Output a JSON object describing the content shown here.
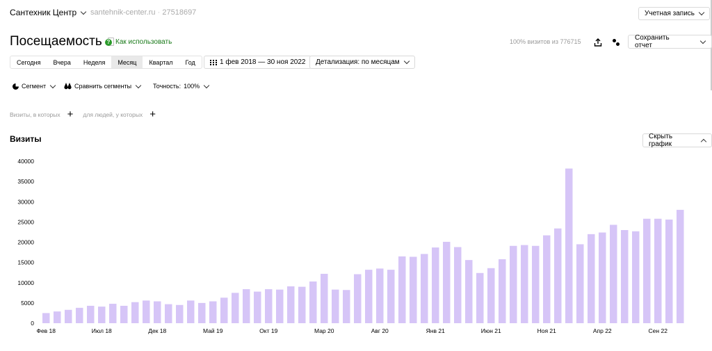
{
  "header": {
    "site_name": "Сантехник Центр",
    "site_url": "santehnik-center.ru",
    "counter_id": "27518697",
    "account_label": "Учетная запись"
  },
  "report": {
    "title": "Посещаемость",
    "howto_label": "Как использовать",
    "visits_info": "100% визитов из 776715",
    "save_label": "Сохранить отчет"
  },
  "periods": [
    "Сегодня",
    "Вчера",
    "Неделя",
    "Месяц",
    "Квартал",
    "Год"
  ],
  "active_period": "Месяц",
  "date_range": "1 фев 2018 — 30 ноя 2022",
  "detail_label": "Детализация: по месяцам",
  "segment_label": "Сегмент",
  "compare_label": "Сравнить сегменты",
  "accuracy_label": "Точность:",
  "accuracy_value": "100%",
  "filters": {
    "visits_label": "Визиты, в которых",
    "people_label": "для людей, у которых"
  },
  "chart_section": {
    "title": "Визиты",
    "hide_label": "Скрыть график"
  },
  "colors": {
    "bar": "#d6c5f7",
    "accent_green": "#2a9a2a"
  },
  "chart_data": {
    "type": "bar",
    "series": [
      {
        "values": [
          2500,
          2900,
          3300,
          3800,
          4300,
          4100,
          4800,
          4300,
          5200,
          5600,
          5400,
          4700,
          4500,
          5600,
          5000,
          5400,
          6300,
          7500,
          8400,
          7800,
          8400,
          8300,
          9100,
          9000,
          10300,
          12200,
          8300,
          8200,
          12100,
          13200,
          13500,
          13200,
          16500,
          16400,
          17100,
          18700,
          20100,
          18800,
          15600,
          12400,
          13600,
          15800,
          19100,
          19300,
          19100,
          21700,
          23400,
          38200,
          19500,
          22000,
          22400,
          24300,
          23000,
          22700,
          25800,
          25800,
          25600,
          28000
        ]
      }
    ],
    "x_tick_labels": [
      {
        "index": 0,
        "label": "Фев 18"
      },
      {
        "index": 5,
        "label": "Июл 18"
      },
      {
        "index": 10,
        "label": "Дек 18"
      },
      {
        "index": 15,
        "label": "Май 19"
      },
      {
        "index": 20,
        "label": "Окт 19"
      },
      {
        "index": 25,
        "label": "Мар 20"
      },
      {
        "index": 30,
        "label": "Авг 20"
      },
      {
        "index": 35,
        "label": "Янв 21"
      },
      {
        "index": 40,
        "label": "Июн 21"
      },
      {
        "index": 45,
        "label": "Ноя 21"
      },
      {
        "index": 50,
        "label": "Апр 22"
      },
      {
        "index": 55,
        "label": "Сен 22"
      }
    ],
    "y_ticks": [
      0,
      5000,
      10000,
      15000,
      20000,
      25000,
      30000,
      35000,
      40000
    ],
    "ylim": [
      0,
      40000
    ],
    "grid": false
  }
}
